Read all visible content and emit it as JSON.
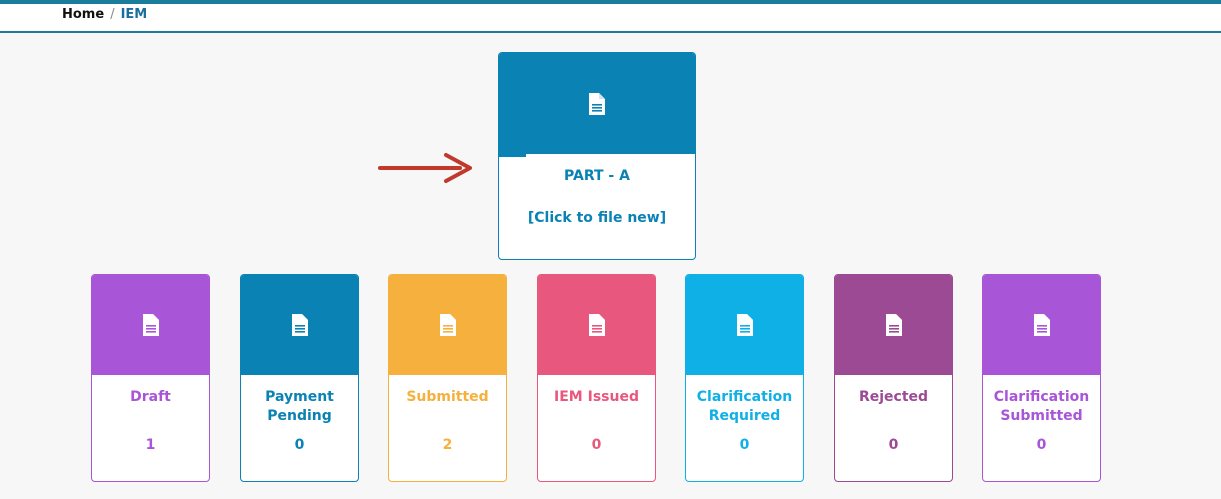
{
  "breadcrumb": {
    "home": "Home",
    "separator": "/",
    "current": "IEM"
  },
  "part_a": {
    "title": "PART - A",
    "action": "[Click to file new]",
    "color": "#0a82b3",
    "icon": "document-icon"
  },
  "annotation": {
    "arrow_color": "#c0392b",
    "icon": "right-arrow-icon"
  },
  "status_cards": [
    {
      "label": "Draft",
      "count": "1",
      "color": "#a855d8",
      "icon": "document-icon"
    },
    {
      "label": "Payment Pending",
      "count": "0",
      "color": "#0a82b3",
      "icon": "document-icon"
    },
    {
      "label": "Submitted",
      "count": "2",
      "color": "#f5b03e",
      "icon": "document-icon"
    },
    {
      "label": "IEM Issued",
      "count": "0",
      "color": "#e8577d",
      "icon": "document-icon"
    },
    {
      "label": "Clarification Required",
      "count": "0",
      "color": "#0fb0e6",
      "icon": "document-icon"
    },
    {
      "label": "Rejected",
      "count": "0",
      "color": "#9b4a93",
      "icon": "document-icon"
    },
    {
      "label": "Clarification Submitted",
      "count": "0",
      "color": "#a855d8",
      "icon": "document-icon"
    }
  ]
}
